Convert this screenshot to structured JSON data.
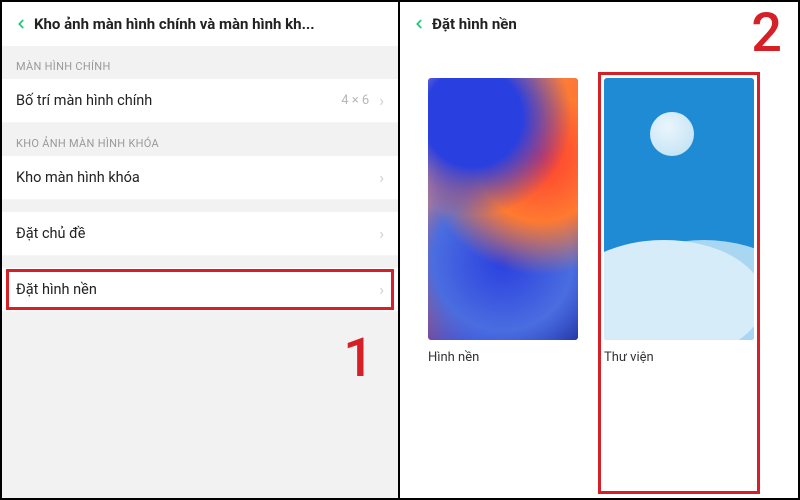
{
  "left": {
    "title": "Kho ảnh màn hình chính và màn hình kh...",
    "section1": "MÀN HÌNH CHÍNH",
    "row_layout": {
      "label": "Bố trí màn hình chính",
      "value": "4 × 6"
    },
    "section2": "KHO ẢNH MÀN HÌNH KHÓA",
    "row_lockstore": {
      "label": "Kho màn hình khóa"
    },
    "row_theme": {
      "label": "Đặt chủ đề"
    },
    "row_wallpaper": {
      "label": "Đặt hình nền"
    },
    "step": "1"
  },
  "right": {
    "title": "Đặt hình nền",
    "card_wallpaper": "Hình nền",
    "card_gallery": "Thư viện",
    "step": "2"
  },
  "icons": {
    "chevron": "›"
  }
}
